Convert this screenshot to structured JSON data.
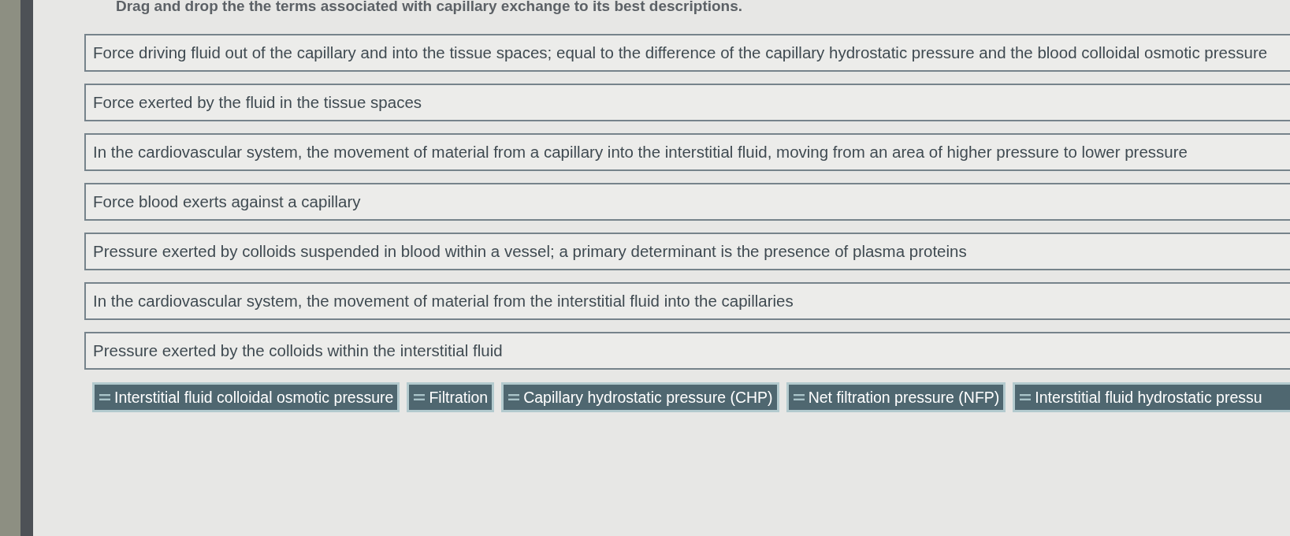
{
  "instruction": "Drag and drop the the terms associated with capillary exchange to its best descriptions.",
  "descriptions": [
    "Force driving fluid out of the capillary and into the tissue spaces; equal to the difference of the capillary hydrostatic pressure and the blood colloidal osmotic pressure",
    "Force exerted by the fluid in the tissue spaces",
    "In the cardiovascular system, the movement of material from a capillary into the interstitial fluid, moving from an area of higher pressure to lower pressure",
    "Force blood exerts against a capillary",
    "Pressure exerted by colloids suspended in blood within a vessel; a primary determinant is the presence of plasma proteins",
    "In the cardiovascular system, the movement of material from the interstitial fluid into the capillaries",
    "Pressure exerted by the colloids within the interstitial fluid"
  ],
  "terms": [
    "Interstitial fluid colloidal osmotic pressure",
    "Filtration",
    "Capillary hydrostatic pressure (CHP)",
    "Net filtration pressure (NFP)",
    "Interstitial fluid hydrostatic pressu"
  ]
}
